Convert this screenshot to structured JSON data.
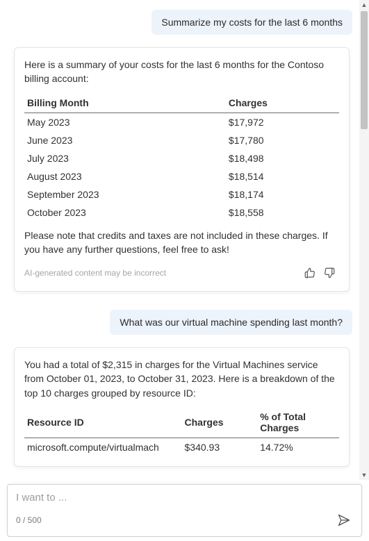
{
  "user_msg1": "Summarize my costs for the last 6 months",
  "ai1": {
    "intro": "Here is a summary of your costs for the last 6 months for the Contoso billing account:",
    "th1": "Billing Month",
    "th2": "Charges",
    "rows": [
      {
        "month": "May 2023",
        "charges": "$17,972"
      },
      {
        "month": "June 2023",
        "charges": "$17,780"
      },
      {
        "month": "July 2023",
        "charges": "$18,498"
      },
      {
        "month": "August 2023",
        "charges": "$18,514"
      },
      {
        "month": "September 2023",
        "charges": "$18,174"
      },
      {
        "month": "October 2023",
        "charges": "$18,558"
      }
    ],
    "outro": "Please note that credits and taxes are not included in these charges. If you have any further questions, feel free to ask!",
    "disclaimer": "AI-generated content may be incorrect"
  },
  "user_msg2": "What was our virtual machine spending last month?",
  "ai2": {
    "intro": "You had a total of $2,315 in charges for the Virtual Machines service from October 01, 2023, to October 31, 2023. Here is a breakdown of the top 10 charges grouped by resource ID:",
    "th1": "Resource ID",
    "th2": "Charges",
    "th3": "% of Total Charges",
    "rows": [
      {
        "id": "microsoft.compute/virtualmach",
        "charges": "$340.93",
        "pct": "14.72%"
      }
    ]
  },
  "input": {
    "placeholder": "I want to ...",
    "counter": "0 / 500"
  }
}
